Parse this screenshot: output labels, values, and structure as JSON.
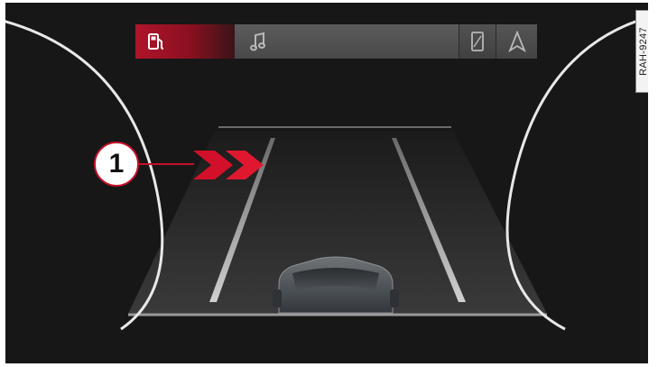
{
  "tabs": [
    {
      "id": "fuel",
      "icon": "fuel-pump-icon",
      "active": true
    },
    {
      "id": "music",
      "icon": "music-note-icon",
      "active": false
    },
    {
      "id": "phone",
      "icon": "phone-icon",
      "active": false
    },
    {
      "id": "navigation",
      "icon": "navigation-arrow-icon",
      "active": false
    }
  ],
  "callout": {
    "label": "1"
  },
  "reference": {
    "code": "RAH-9247"
  },
  "colors": {
    "active_tab": "#b0142a",
    "warning_chevrons": "#d3102a",
    "gauge_arc": "#e8e8e8",
    "display_bg": "#171717"
  }
}
